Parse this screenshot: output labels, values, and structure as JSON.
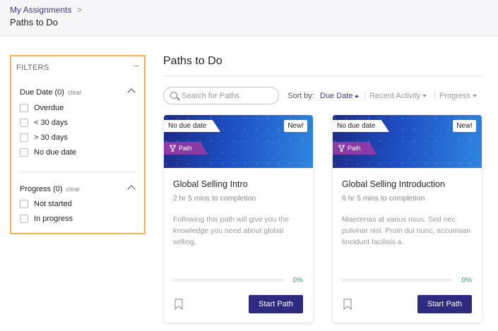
{
  "breadcrumb": {
    "parent": "My Assignments",
    "separator": ">",
    "current": "Paths to Do"
  },
  "filters": {
    "heading": "FILTERS",
    "collapse_symbol": "−",
    "due_date": {
      "title": "Due Date (0)",
      "clear": "clear",
      "options": [
        "Overdue",
        "< 30 days",
        "> 30 days",
        "No due date"
      ]
    },
    "progress": {
      "title": "Progress (0)",
      "clear": "clear",
      "options": [
        "Not started",
        "In progress"
      ]
    }
  },
  "main": {
    "title": "Paths to Do",
    "search": {
      "placeholder": "Search for Paths",
      "value": ""
    },
    "sort": {
      "label": "Sort by:",
      "options": [
        {
          "label": "Due Date",
          "active": true
        },
        {
          "label": "Recent Activity",
          "active": false
        },
        {
          "label": "Progress",
          "active": false
        }
      ]
    }
  },
  "cards": [
    {
      "due_tag": "No due date",
      "new_tag": "New!",
      "type_tag": "Path",
      "title": "Global Selling Intro",
      "duration": "2 hr 5 mins to completion",
      "description": "Following this path will give you the knowledge you need about global selling.",
      "progress_percent": 0,
      "progress_label": "0%",
      "button": "Start Path"
    },
    {
      "due_tag": "No due date",
      "new_tag": "New!",
      "type_tag": "Path",
      "title": "Global Selling Introduction",
      "duration": "6 hr 5 mins to completion",
      "description": "Maecenas at varius risus. Sed nec pulvinar nisl. Proin dui nunc, accumsan tincidunt facilisis a.",
      "progress_percent": 0,
      "progress_label": "0%",
      "button": "Start Path"
    }
  ],
  "colors": {
    "accent": "#2e2a80",
    "link": "#3b3a8c",
    "filter_border": "#f5b14a",
    "path_tag": "#8b3aa8",
    "progress": "#2fa36b"
  }
}
